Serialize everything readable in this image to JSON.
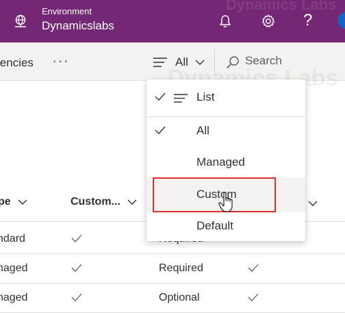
{
  "header": {
    "environment_label": "Environment",
    "environment_name": "Dynamicslabs",
    "help_glyph": "?",
    "watermark": "Dynamics Labs",
    "bg_color": "#742774"
  },
  "command_bar": {
    "partial_tab": "lencies",
    "more_glyph": "···",
    "filter": {
      "selected": "All",
      "icon": "list-lines-icon"
    },
    "search": {
      "placeholder": "Search"
    }
  },
  "table": {
    "headers": [
      {
        "label": "pe"
      },
      {
        "label": "Custom..."
      }
    ],
    "rows": [
      {
        "col1": "ndard",
        "custom_checked": true,
        "col3": "Required",
        "col4_checked": false
      },
      {
        "col1": "naged",
        "custom_checked": true,
        "col3": "Required",
        "col4_checked": true
      },
      {
        "col1": "naged",
        "custom_checked": true,
        "col3": "Optional",
        "col4_checked": true
      }
    ]
  },
  "dropdown": {
    "view_item": {
      "label": "List",
      "checked": true
    },
    "items": [
      {
        "label": "All",
        "checked": true
      },
      {
        "label": "Managed",
        "checked": false
      },
      {
        "label": "Custom",
        "checked": false,
        "hovered": true
      },
      {
        "label": "Default",
        "checked": false
      }
    ],
    "highlight_color": "#d9302c"
  }
}
